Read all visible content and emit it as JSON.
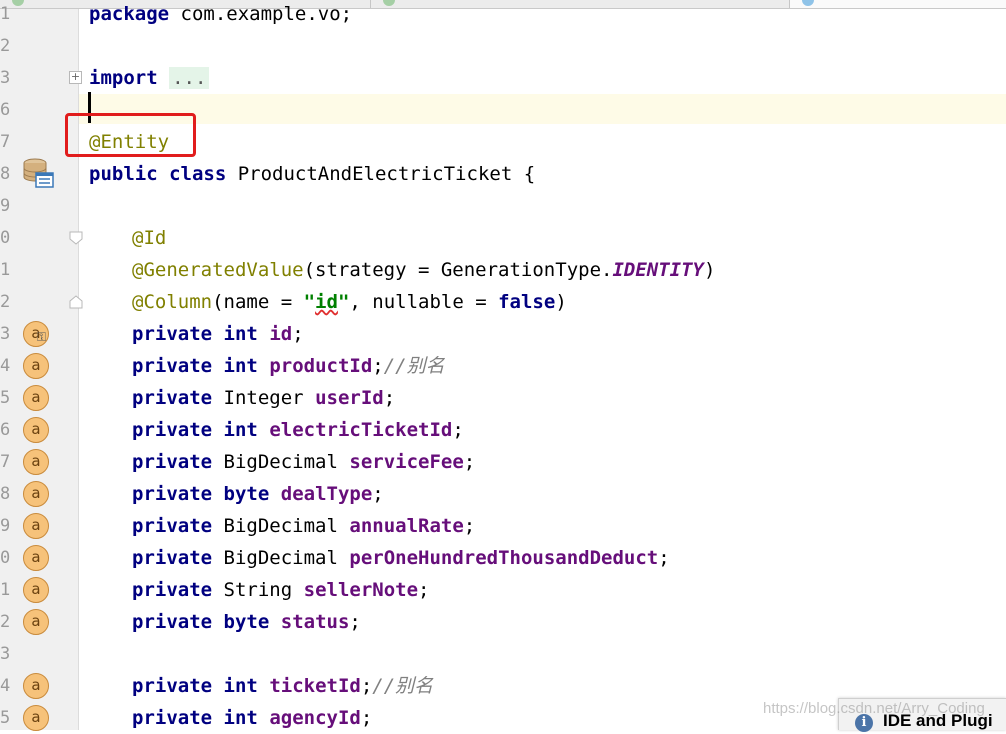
{
  "tabs": [
    "",
    "",
    ""
  ],
  "gutter": {
    "line_numbers": [
      "1",
      "2",
      "3",
      "6",
      "7",
      "8",
      "9",
      "0",
      "1",
      "2",
      "3",
      "4",
      "5",
      "6",
      "7",
      "8",
      "9",
      "0",
      "1",
      "2",
      "3",
      "4",
      "5"
    ],
    "field_icon_label": "a",
    "fold_expand_label": "+"
  },
  "editor": {
    "line_package": {
      "kw": "package",
      "rest": " com.example.vo;"
    },
    "line_import": {
      "kw": "import",
      "space": " ",
      "folded": "..."
    },
    "line_entity": {
      "ann": "@Entity"
    },
    "line_class": {
      "kw": "public class",
      "rest": " ProductAndElectricTicket {"
    },
    "line_id_ann": {
      "ann": "@Id"
    },
    "line_generated": {
      "ann": "@GeneratedValue",
      "rest": "(strategy = GenerationType.",
      "const": "IDENTITY",
      "close": ")"
    },
    "line_column": {
      "ann": "@Column",
      "p1": "(name = ",
      "str_open": "\"",
      "str_err": "id",
      "str_close": "\"",
      "p2": ", nullable = ",
      "kw": "false",
      "p3": ")"
    },
    "fields": [
      {
        "mod": "private",
        "type_kw": "int",
        "type": "",
        "name": "id",
        "comment": ""
      },
      {
        "mod": "private",
        "type_kw": "int",
        "type": "",
        "name": "productId",
        "comment": "//别名"
      },
      {
        "mod": "private",
        "type_kw": "",
        "type": "Integer",
        "name": "userId",
        "comment": ""
      },
      {
        "mod": "private",
        "type_kw": "int",
        "type": "",
        "name": "electricTicketId",
        "comment": ""
      },
      {
        "mod": "private",
        "type_kw": "",
        "type": "BigDecimal",
        "name": "serviceFee",
        "comment": ""
      },
      {
        "mod": "private",
        "type_kw": "byte",
        "type": "",
        "name": "dealType",
        "comment": ""
      },
      {
        "mod": "private",
        "type_kw": "",
        "type": "BigDecimal",
        "name": "annualRate",
        "comment": ""
      },
      {
        "mod": "private",
        "type_kw": "",
        "type": "BigDecimal",
        "name": "perOneHundredThousandDeduct",
        "comment": ""
      },
      {
        "mod": "private",
        "type_kw": "",
        "type": "String",
        "name": "sellerNote",
        "comment": ""
      },
      {
        "mod": "private",
        "type_kw": "byte",
        "type": "",
        "name": "status",
        "comment": ""
      },
      {
        "mod": "private",
        "type_kw": "int",
        "type": "",
        "name": "ticketId",
        "comment": "//别名"
      },
      {
        "mod": "private",
        "type_kw": "int",
        "type": "",
        "name": "agencyId",
        "comment": ""
      }
    ]
  },
  "notification": {
    "title": "IDE and Plugi"
  },
  "watermark": "https://blog.csdn.net/Arry_Coding",
  "colors": {
    "highlight_box": "#e11c1c",
    "keyword": "#000080",
    "annotation": "#808000",
    "field": "#660e7a",
    "string": "#008000",
    "caret_line": "#fefbe7"
  }
}
